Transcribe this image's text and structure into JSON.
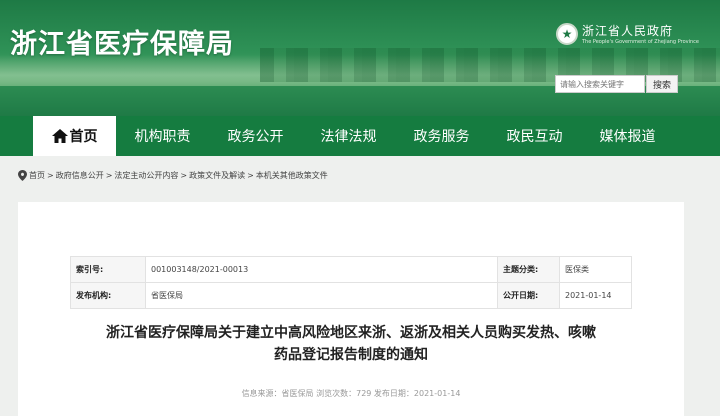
{
  "header": {
    "site_title": "浙江省医疗保障局",
    "gov_logo_cn": "浙江省人民政府",
    "gov_logo_en": "The People's Government of Zhejiang Province",
    "search_placeholder": "请输入搜索关键字",
    "search_button": "搜索"
  },
  "nav": {
    "items": [
      {
        "label": "首页"
      },
      {
        "label": "机构职责"
      },
      {
        "label": "政务公开"
      },
      {
        "label": "法律法规"
      },
      {
        "label": "政务服务"
      },
      {
        "label": "政民互动"
      },
      {
        "label": "媒体报道"
      }
    ]
  },
  "breadcrumb": {
    "items": [
      "首页",
      "政府信息公开",
      "法定主动公开内容",
      "政策文件及解读",
      "本机关其他政策文件"
    ],
    "separator": ">"
  },
  "meta": {
    "index_label": "索引号:",
    "index_value": "001003148/2021-00013",
    "topic_label": "主题分类:",
    "topic_value": "医保类",
    "publisher_label": "发布机构:",
    "publisher_value": "省医保局",
    "date_label": "公开日期:",
    "date_value": "2021-01-14"
  },
  "document": {
    "title_line1": "浙江省医疗保障局关于建立中高风险地区来浙、返浙及相关人员购买发热、咳嗽",
    "title_line2": "药品登记报告制度的通知",
    "info": "信息来源：省医保局 浏览次数：729 发布日期：2021-01-14"
  },
  "colors": {
    "nav_bg": "#157c40",
    "banner_green": "#1e7a45"
  }
}
